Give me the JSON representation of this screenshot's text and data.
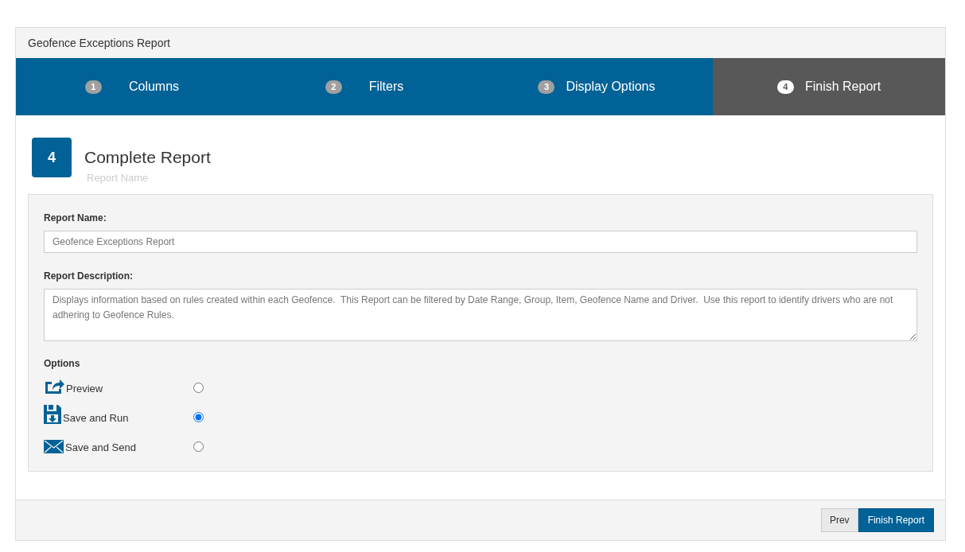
{
  "panel_title": "Geofence Exceptions Report",
  "steps": [
    {
      "number": "1",
      "label": "Columns",
      "selected": false
    },
    {
      "number": "2",
      "label": "Filters",
      "selected": false
    },
    {
      "number": "3",
      "label": "Display Options",
      "selected": false
    },
    {
      "number": "4",
      "label": "Finish Report",
      "selected": true
    }
  ],
  "section": {
    "number": "4",
    "title": "Complete Report",
    "subtitle": "Report Name"
  },
  "form": {
    "name_label": "Report Name:",
    "name_value": "Geofence Exceptions Report",
    "description_label": "Report Description:",
    "description_value": "Displays information based on rules created within each Geofence.  This Report can be filtered by Date Range, Group, Item, Geofence Name and Driver.  Use this report to identify drivers who are not adhering to Geofence Rules."
  },
  "options": {
    "label": "Options",
    "items": [
      {
        "kind": "preview",
        "label": "Preview",
        "selected": false
      },
      {
        "kind": "save",
        "label": "Save and Run",
        "selected": true
      },
      {
        "kind": "send",
        "label": "Save and Send",
        "selected": false
      }
    ]
  },
  "buttons": {
    "prev": "Prev",
    "finish": "Finish Report"
  }
}
